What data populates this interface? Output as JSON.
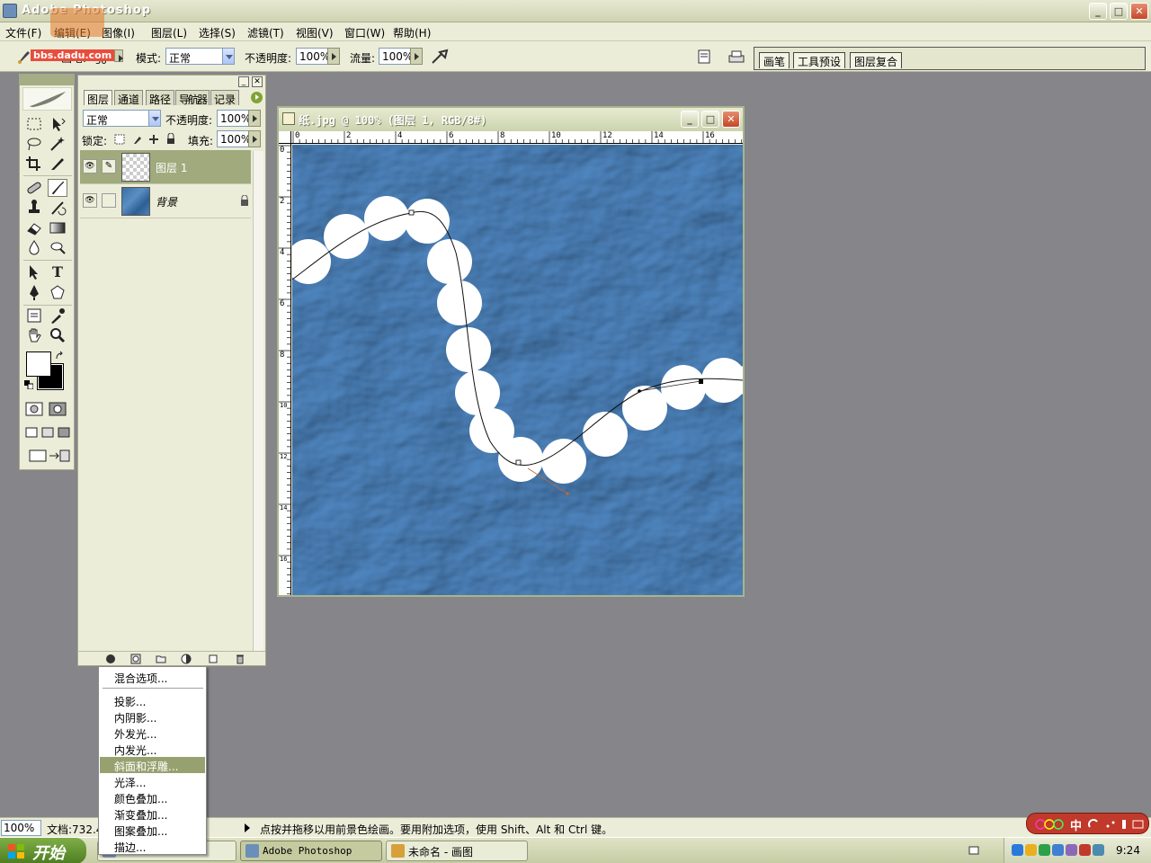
{
  "window": {
    "title": "Adobe Photoshop",
    "min": "_",
    "max": "□",
    "close": "✕"
  },
  "watermark": {
    "text": "bbs.dadu.com"
  },
  "menubar": {
    "items": [
      "文件(F)",
      "编辑(E)",
      "图像(I)",
      "图层(L)",
      "选择(S)",
      "滤镜(T)",
      "视图(V)",
      "窗口(W)",
      "帮助(H)"
    ]
  },
  "options": {
    "brush_label": "画笔:",
    "brush_size": "50",
    "mode_label": "模式:",
    "mode_value": "正常",
    "opacity_label": "不透明度:",
    "opacity_value": "100%",
    "flow_label": "流量:",
    "flow_value": "100%",
    "well_tabs": [
      "画笔",
      "工具预设",
      "图层复合"
    ]
  },
  "toolbox": {
    "tools": [
      "marquee-icon",
      "move-icon",
      "lasso-icon",
      "magic-wand-icon",
      "crop-icon",
      "slice-icon",
      "healing-brush-icon",
      "brush-icon",
      "clone-stamp-icon",
      "history-brush-icon",
      "eraser-icon",
      "gradient-icon",
      "blur-icon",
      "dodge-icon",
      "path-select-icon",
      "type-icon",
      "pen-icon",
      "shape-icon",
      "notes-icon",
      "eyedropper-icon",
      "hand-icon",
      "zoom-icon"
    ],
    "type_glyph": "T",
    "fg_color": "#ffffff",
    "bg_color": "#000000"
  },
  "layers_panel": {
    "tabs": [
      "图层",
      "通道",
      "路径",
      "导航器",
      "记录"
    ],
    "blend_mode": "正常",
    "opacity_label": "不透明度:",
    "opacity_value": "100%",
    "lock_label": "锁定:",
    "fill_label": "填充:",
    "fill_value": "100%",
    "layers": [
      {
        "name": "图层 1",
        "selected": true
      },
      {
        "name": "背景",
        "selected": false
      }
    ]
  },
  "context_menu": {
    "items": [
      "混合选项...",
      "投影...",
      "内阴影...",
      "外发光...",
      "内发光...",
      "斜面和浮雕...",
      "光泽...",
      "颜色叠加...",
      "渐变叠加...",
      "图案叠加...",
      "描边..."
    ],
    "highlighted": "斜面和浮雕..."
  },
  "document": {
    "title": "纸.jpg @ 100% (图层 1, RGB/8#)",
    "ruler_top": [
      "0",
      "2",
      "4",
      "6",
      "8",
      "10",
      "12",
      "14",
      "16"
    ],
    "ruler_left": [
      "0",
      "2",
      "4",
      "6",
      "8",
      "10",
      "12",
      "14",
      "16"
    ]
  },
  "status": {
    "zoom": "100%",
    "doc_size": "文档:732.4",
    "hint": "点按并拖移以用前景色绘画。要用附加选项，使用 Shift、Alt 和 Ctrl 键。"
  },
  "ime": {
    "label": "中"
  },
  "taskbar": {
    "start": "开始",
    "tasks": [
      {
        "label": "Adobe Photoshop",
        "active": true
      },
      {
        "label": "未命名 - 画图",
        "active": false
      }
    ],
    "clock": "9:24"
  }
}
